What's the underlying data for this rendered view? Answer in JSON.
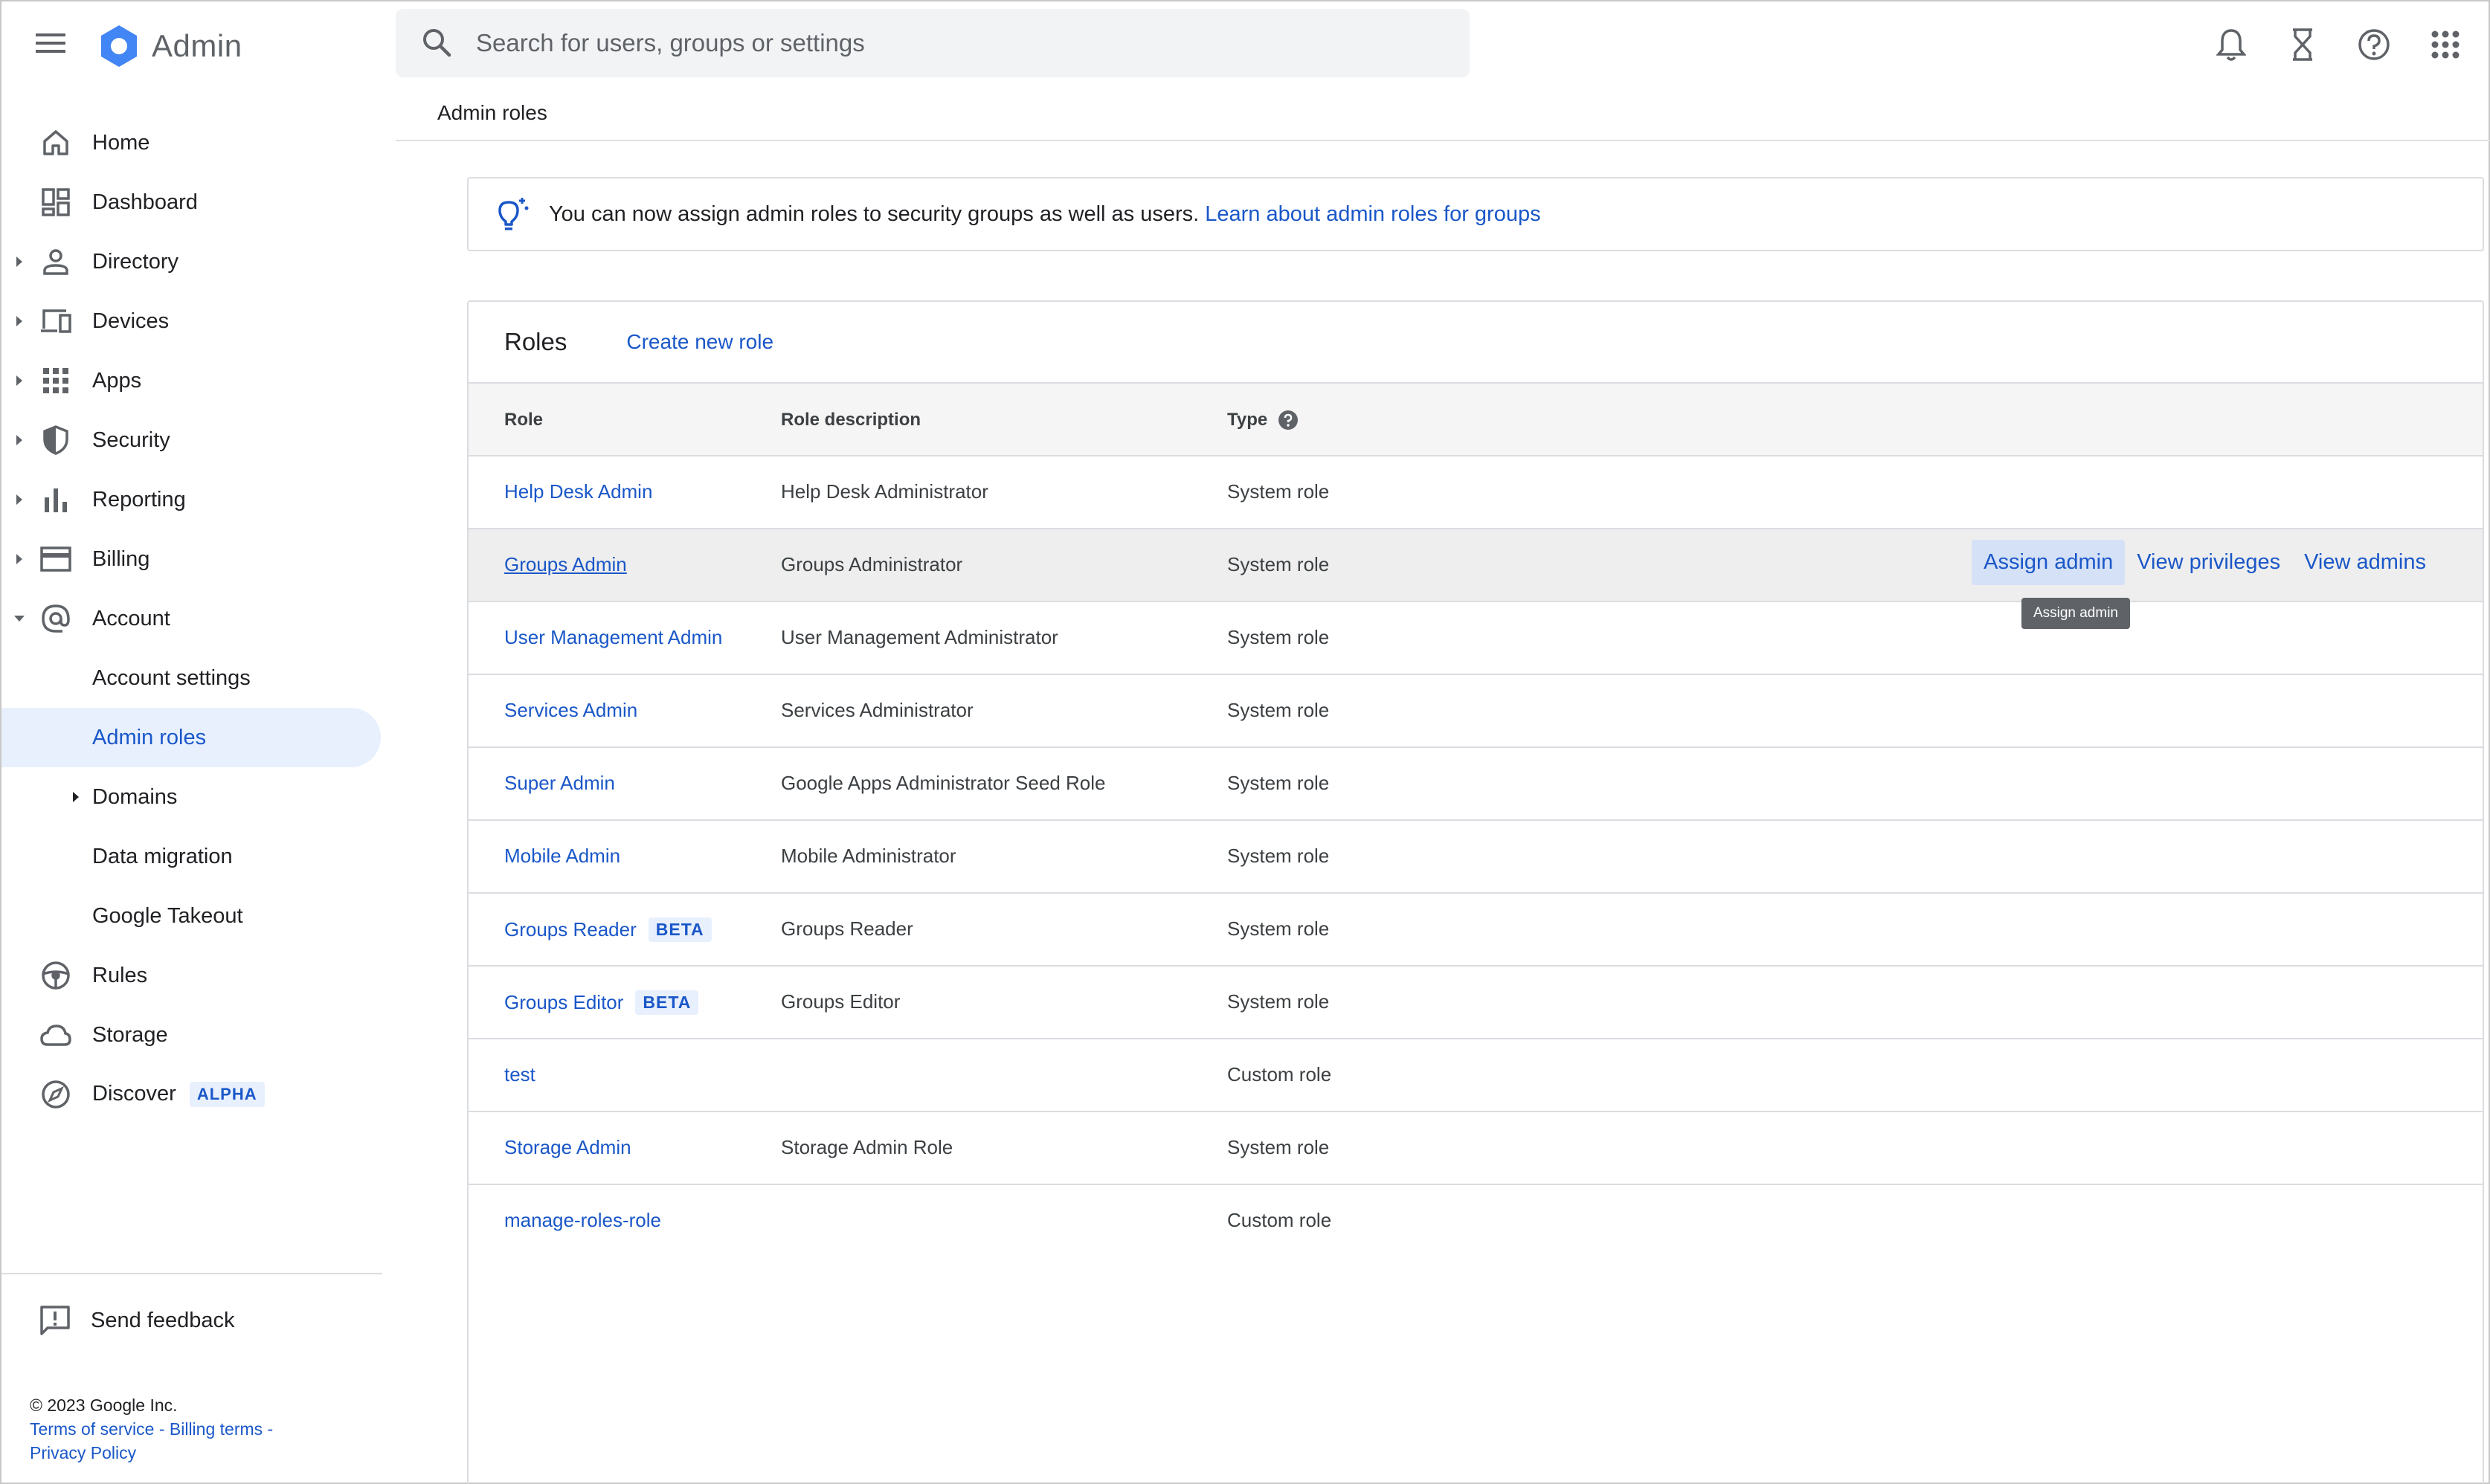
{
  "app": {
    "title": "Admin",
    "brand_color": "#4285f4"
  },
  "search": {
    "placeholder": "Search for users, groups or settings"
  },
  "top_icons": [
    "notifications-icon",
    "hourglass-icon",
    "help-icon",
    "apps-grid-icon"
  ],
  "sidebar": {
    "items": [
      {
        "label": "Home",
        "icon": "home-icon",
        "expandable": false
      },
      {
        "label": "Dashboard",
        "icon": "dashboard-icon",
        "expandable": false
      },
      {
        "label": "Directory",
        "icon": "person-icon",
        "expandable": true
      },
      {
        "label": "Devices",
        "icon": "devices-icon",
        "expandable": true
      },
      {
        "label": "Apps",
        "icon": "apps-icon",
        "expandable": true
      },
      {
        "label": "Security",
        "icon": "shield-icon",
        "expandable": true
      },
      {
        "label": "Reporting",
        "icon": "bar-chart-icon",
        "expandable": true
      },
      {
        "label": "Billing",
        "icon": "credit-card-icon",
        "expandable": true
      },
      {
        "label": "Account",
        "icon": "at-sign-icon",
        "expandable": true,
        "expanded": true
      },
      {
        "label": "Account settings",
        "sub": true
      },
      {
        "label": "Admin roles",
        "sub": true,
        "active": true
      },
      {
        "label": "Domains",
        "sub": true,
        "expandable": true
      },
      {
        "label": "Data migration",
        "sub": true
      },
      {
        "label": "Google Takeout",
        "sub": true
      },
      {
        "label": "Rules",
        "icon": "steering-wheel-icon",
        "expandable": false
      },
      {
        "label": "Storage",
        "icon": "cloud-icon",
        "expandable": false
      },
      {
        "label": "Discover",
        "icon": "compass-icon",
        "expandable": false,
        "badge": "ALPHA"
      }
    ],
    "feedback_label": "Send feedback",
    "footer": {
      "copyright": "© 2023 Google Inc.",
      "terms": "Terms of service",
      "billing_terms": "Billing terms",
      "privacy": "Privacy Policy",
      "separator": " - "
    }
  },
  "breadcrumb": "Admin roles",
  "banner": {
    "text": "You can now assign admin roles to security groups as well as users.",
    "link": "Learn about admin roles for groups"
  },
  "roles_card": {
    "title": "Roles",
    "create_link": "Create new role",
    "columns": {
      "role": "Role",
      "description": "Role description",
      "type": "Type"
    },
    "rows": [
      {
        "role": "Help Desk Admin",
        "description": "Help Desk Administrator",
        "type": "System role"
      },
      {
        "role": "Groups Admin",
        "description": "Groups Administrator",
        "type": "System role",
        "hover": true
      },
      {
        "role": "User Management Admin",
        "description": "User Management Administrator",
        "type": "System role"
      },
      {
        "role": "Services Admin",
        "description": "Services Administrator",
        "type": "System role"
      },
      {
        "role": "Super Admin",
        "description": "Google Apps Administrator Seed Role",
        "type": "System role"
      },
      {
        "role": "Mobile Admin",
        "description": "Mobile Administrator",
        "type": "System role"
      },
      {
        "role": "Groups Reader",
        "badge": "BETA",
        "description": "Groups Reader",
        "type": "System role"
      },
      {
        "role": "Groups Editor",
        "badge": "BETA",
        "description": "Groups Editor",
        "type": "System role"
      },
      {
        "role": "test",
        "description": "",
        "type": "Custom role"
      },
      {
        "role": "Storage Admin",
        "description": "Storage Admin Role",
        "type": "System role"
      },
      {
        "role": "manage-roles-role",
        "description": "",
        "type": "Custom role"
      }
    ],
    "row_actions": {
      "assign": "Assign admin",
      "privileges": "View privileges",
      "admins": "View admins"
    },
    "tooltip": "Assign admin"
  }
}
